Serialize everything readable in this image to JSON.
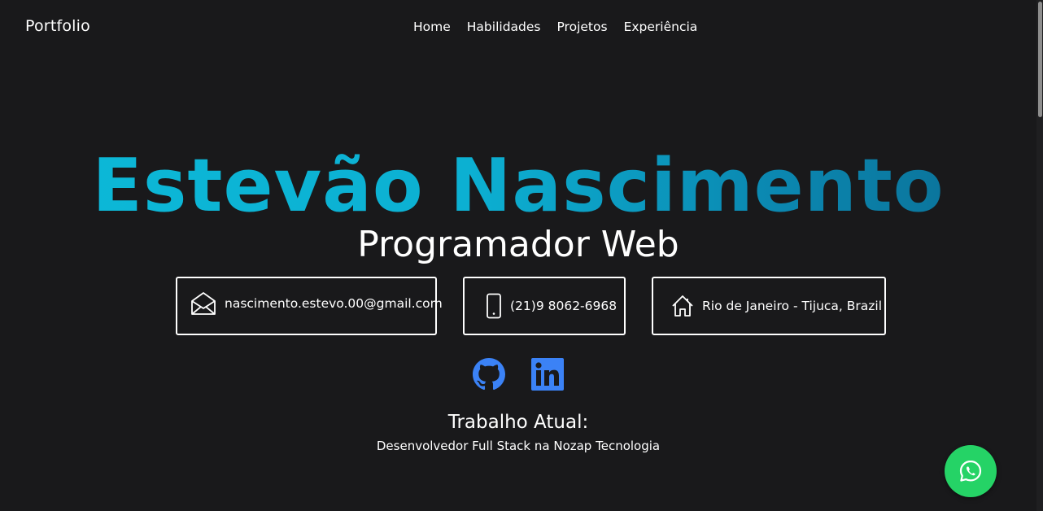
{
  "navbar": {
    "brand": "Portfolio",
    "links": [
      "Home",
      "Habilidades",
      "Projetos",
      "Experiência"
    ]
  },
  "hero": {
    "name": "Estevão Nascimento",
    "role": "Programador Web",
    "name_gradient": [
      "#0cb9d8",
      "#0b6c92"
    ]
  },
  "contacts": {
    "email": {
      "icon": "envelope-icon",
      "text": "nascimento.estevo.00@gmail.com"
    },
    "phone": {
      "icon": "phone-icon",
      "text": "(21)9 8062-6968"
    },
    "location": {
      "icon": "home-icon",
      "text": "Rio de Janeiro - Tijuca, Brazil"
    }
  },
  "social": {
    "github": {
      "icon": "github-icon",
      "color": "#3b82f6"
    },
    "linkedin": {
      "icon": "linkedin-icon",
      "color": "#3b82f6"
    }
  },
  "work": {
    "title": "Trabalho Atual:",
    "description": "Desenvolvedor Full Stack na Nozap Tecnologia"
  },
  "whatsapp": {
    "icon": "whatsapp-icon",
    "color": "#25d366"
  },
  "colors": {
    "background": "#19191b",
    "text": "#ffffff"
  }
}
